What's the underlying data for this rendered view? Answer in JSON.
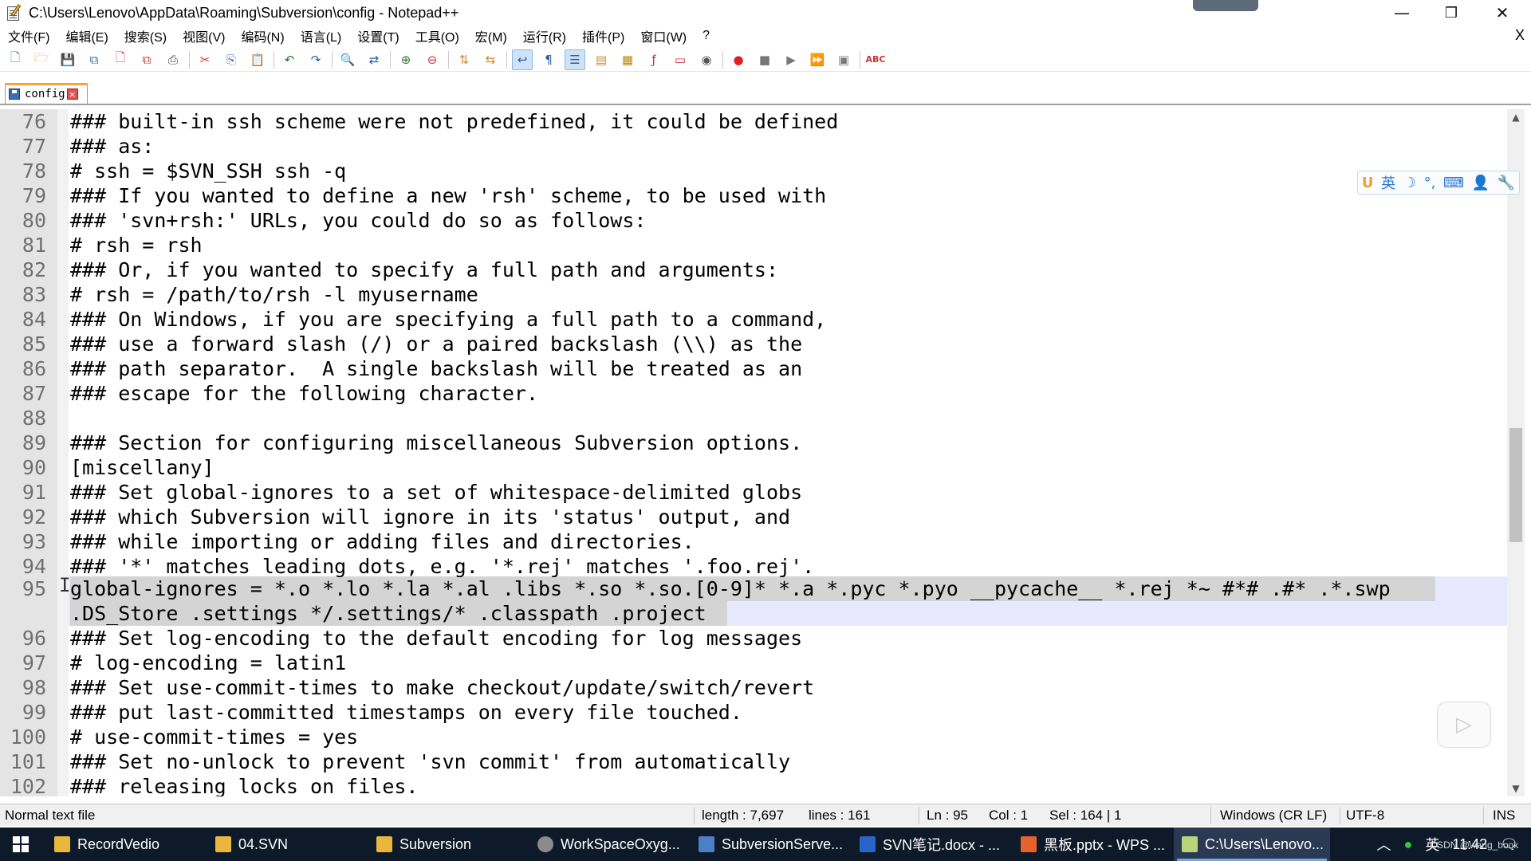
{
  "window": {
    "title": "C:\\Users\\Lenovo\\AppData\\Roaming\\Subversion\\config - Notepad++",
    "minimize": "—",
    "maximize": "❐",
    "close": "✕"
  },
  "menu": {
    "items": [
      "文件(F)",
      "编辑(E)",
      "搜索(S)",
      "视图(V)",
      "编码(N)",
      "语言(L)",
      "设置(T)",
      "工具(O)",
      "宏(M)",
      "运行(R)",
      "插件(P)",
      "窗口(W)",
      "?"
    ],
    "close_label": "X"
  },
  "tab": {
    "label": "config",
    "close_glyph": "×"
  },
  "editor": {
    "lines": [
      {
        "n": "76",
        "text": "### built-in ssh scheme were not predefined, it could be defined"
      },
      {
        "n": "77",
        "text": "### as:"
      },
      {
        "n": "78",
        "text": "# ssh = $SVN_SSH ssh -q"
      },
      {
        "n": "79",
        "text": "### If you wanted to define a new 'rsh' scheme, to be used with"
      },
      {
        "n": "80",
        "text": "### 'svn+rsh:' URLs, you could do so as follows:"
      },
      {
        "n": "81",
        "text": "# rsh = rsh"
      },
      {
        "n": "82",
        "text": "### Or, if you wanted to specify a full path and arguments:"
      },
      {
        "n": "83",
        "text": "# rsh = /path/to/rsh -l myusername"
      },
      {
        "n": "84",
        "text": "### On Windows, if you are specifying a full path to a command,"
      },
      {
        "n": "85",
        "text": "### use a forward slash (/) or a paired backslash (\\\\) as the"
      },
      {
        "n": "86",
        "text": "### path separator.  A single backslash will be treated as an"
      },
      {
        "n": "87",
        "text": "### escape for the following character."
      },
      {
        "n": "88",
        "text": ""
      },
      {
        "n": "89",
        "text": "### Section for configuring miscellaneous Subversion options."
      },
      {
        "n": "90",
        "text": "[miscellany]"
      },
      {
        "n": "91",
        "text": "### Set global-ignores to a set of whitespace-delimited globs"
      },
      {
        "n": "92",
        "text": "### which Subversion will ignore in its 'status' output, and"
      },
      {
        "n": "93",
        "text": "### while importing or adding files and directories."
      },
      {
        "n": "94",
        "text": "### '*' matches leading dots, e.g. '*.rej' matches '.foo.rej'."
      },
      {
        "n": "95",
        "text": "global-ignores = *.o *.lo *.la *.al .libs *.so *.so.[0-9]* *.a *.pyc *.pyo __pycache__ *.rej *~ #*# .#* .*.swp"
      },
      {
        "n": "",
        "text": ".DS_Store .settings */.settings/* .classpath .project"
      },
      {
        "n": "96",
        "text": "### Set log-encoding to the default encoding for log messages"
      },
      {
        "n": "97",
        "text": "# log-encoding = latin1"
      },
      {
        "n": "98",
        "text": "### Set use-commit-times to make checkout/update/switch/revert"
      },
      {
        "n": "99",
        "text": "### put last-committed timestamps on every file touched."
      },
      {
        "n": "100",
        "text": "# use-commit-times = yes"
      },
      {
        "n": "101",
        "text": "### Set no-unlock to prevent 'svn commit' from automatically"
      },
      {
        "n": "102",
        "text": "### releasing locks on files."
      }
    ]
  },
  "ime": {
    "logo": "U",
    "lang": "英",
    "moon": "☽",
    "punct": "°,",
    "keyboard": "⌨",
    "user": "👤",
    "tools": "🔧"
  },
  "status": {
    "file_type": "Normal text file",
    "length": "length : 7,697",
    "lines": "lines : 161",
    "ln": "Ln : 95",
    "col": "Col : 1",
    "sel": "Sel : 164 | 1",
    "eol": "Windows (CR LF)",
    "encoding": "UTF-8",
    "mode": "INS"
  },
  "taskbar": {
    "tasks": [
      {
        "label": "RecordVedio",
        "color": "#e9b73c"
      },
      {
        "label": "04.SVN",
        "color": "#e9b73c"
      },
      {
        "label": "Subversion",
        "color": "#e9b73c"
      },
      {
        "label": "WorkSpaceOxyg...",
        "color": "#8a8a8a"
      },
      {
        "label": "SubversionServe...",
        "color": "#4d7fc9"
      },
      {
        "label": "SVN笔记.docx - ...",
        "color": "#2b64c8"
      },
      {
        "label": "黑板.pptx - WPS ...",
        "color": "#e5622c"
      },
      {
        "label": "C:\\Users\\Lenovo...",
        "color": "#b9d47a"
      }
    ],
    "tray_ime": "英",
    "clock": "11:42",
    "watermark": "CSDN @wang_book"
  }
}
